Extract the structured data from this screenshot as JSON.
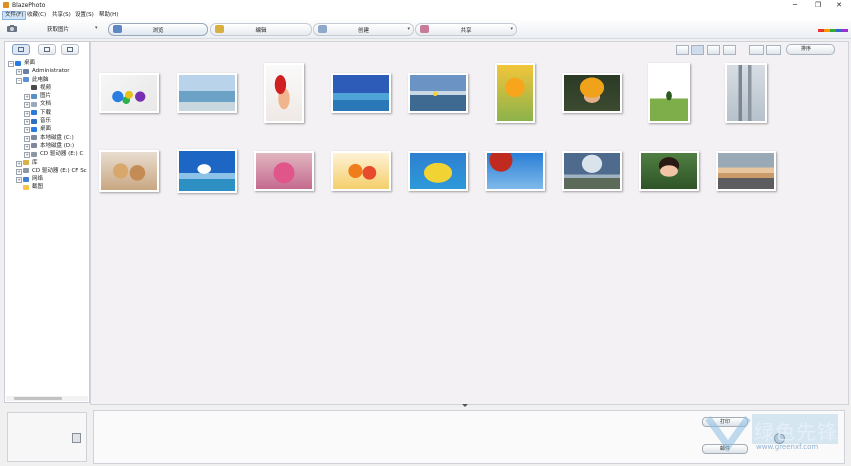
{
  "window": {
    "title": "BlazePhoto",
    "controls": {
      "minimize": "─",
      "maximize": "❐",
      "close": "✕"
    }
  },
  "menu": [
    {
      "label": "文件(F)",
      "active": true
    },
    {
      "label": "收藏(C)",
      "active": false
    },
    {
      "label": "共享(S)",
      "active": false
    },
    {
      "label": "设置(S)",
      "active": false
    },
    {
      "label": "帮助(H)",
      "active": false
    }
  ],
  "toolbar": {
    "import_label": "获取图片",
    "tabs": [
      {
        "label": "浏览",
        "selected": true,
        "icon": "browse-icon"
      },
      {
        "label": "编辑",
        "selected": false,
        "icon": "edit-icon"
      },
      {
        "label": "创建",
        "selected": false,
        "icon": "create-icon"
      },
      {
        "label": "共享",
        "selected": false,
        "icon": "share-icon"
      }
    ],
    "brand_colors": [
      "#e33",
      "#f90",
      "#3a3",
      "#36c",
      "#93c"
    ]
  },
  "tree": [
    {
      "label": "桌面",
      "level": 0,
      "exp": "−",
      "icon": "desktop-icon",
      "color": "#2a7be0"
    },
    {
      "label": "Administrator",
      "level": 1,
      "exp": "+",
      "icon": "user-icon",
      "color": "#6b7fa6"
    },
    {
      "label": "此电脑",
      "level": 1,
      "exp": "−",
      "icon": "computer-icon",
      "color": "#5b8fd6"
    },
    {
      "label": "视频",
      "level": 2,
      "exp": "",
      "icon": "video-icon",
      "color": "#4a4a4a"
    },
    {
      "label": "图片",
      "level": 2,
      "exp": "+",
      "icon": "pictures-icon",
      "color": "#5a8ec7"
    },
    {
      "label": "文档",
      "level": 2,
      "exp": "+",
      "icon": "documents-icon",
      "color": "#9aa9bb"
    },
    {
      "label": "下载",
      "level": 2,
      "exp": "+",
      "icon": "download-icon",
      "color": "#2b7cd6"
    },
    {
      "label": "音乐",
      "level": 2,
      "exp": "+",
      "icon": "music-icon",
      "color": "#2e6fc0"
    },
    {
      "label": "桌面",
      "level": 2,
      "exp": "+",
      "icon": "desktop-icon",
      "color": "#2a7be0"
    },
    {
      "label": "本地磁盘 (C:)",
      "level": 2,
      "exp": "+",
      "icon": "drive-icon",
      "color": "#7e8a99"
    },
    {
      "label": "本地磁盘 (D:)",
      "level": 2,
      "exp": "+",
      "icon": "drive-icon",
      "color": "#7e8a99"
    },
    {
      "label": "CD 驱动器 (E:) C",
      "level": 2,
      "exp": "+",
      "icon": "cd-drive-icon",
      "color": "#8d96a3"
    },
    {
      "label": "库",
      "level": 1,
      "exp": "+",
      "icon": "library-icon",
      "color": "#d7b24a"
    },
    {
      "label": "CD 驱动器 (E:) CF Sc",
      "level": 1,
      "exp": "+",
      "icon": "cd-drive-icon",
      "color": "#8d96a3"
    },
    {
      "label": "网络",
      "level": 1,
      "exp": "+",
      "icon": "network-icon",
      "color": "#3f7fd0"
    },
    {
      "label": "截图",
      "level": 1,
      "exp": "",
      "icon": "folder-icon",
      "color": "#f3c64b"
    }
  ],
  "viewbar": {
    "sort_label": "排序"
  },
  "photos": [
    {
      "name": "eggs",
      "bg": "linear-gradient(135deg,#f6f6f6,#e8e8e8)",
      "accent": "radial-gradient(circle at 30% 60%,#2a7de1 0 12%,transparent 13%),radial-gradient(circle at 50% 55%,#e6c21e 0 11%,transparent 12%),radial-gradient(circle at 70% 60%,#7a2fb0 0 11%,transparent 12%),radial-gradient(circle at 45% 70%,#2bb24c 0 9%,transparent 10%)"
    },
    {
      "name": "pier",
      "bg": "linear-gradient(#b9d4ea 0 45%,#6da2c7 45% 75%,#c9d8df 75%)",
      "accent": ""
    },
    {
      "name": "santa",
      "bg": "linear-gradient(#fafafa,#efe9e6)",
      "accent": "radial-gradient(ellipse at 40% 35%,#d02020 0 18%,transparent 19%),radial-gradient(ellipse at 50% 60%,#f0b58f 0 22%,transparent 23%)"
    },
    {
      "name": "island",
      "bg": "linear-gradient(#2d5cb8 0 50%,#4ea4d6 50% 70%,#2a78b8 70%)",
      "accent": ""
    },
    {
      "name": "lake",
      "bg": "linear-gradient(#6b93c4 0 45%,#c8d8e4 45% 55%,#3e6a91 55%)",
      "accent": "radial-gradient(circle at 45% 52%,#f3d23c 0 6%,transparent 7%)"
    },
    {
      "name": "yellow-flower",
      "bg": "linear-gradient(#f3c53a,#8bb34b)",
      "accent": "radial-gradient(circle at 50% 40%,#f7a51c 0 25%,transparent 26%)"
    },
    {
      "name": "kid-hat",
      "bg": "linear-gradient(#2b3a25,#3c4a30)",
      "accent": "radial-gradient(ellipse at 50% 35%,#f0a21a 0 30%,transparent 31%),radial-gradient(ellipse at 50% 60%,#e3b089 0 20%,transparent 21%)"
    },
    {
      "name": "tree",
      "bg": "linear-gradient(#ffffff 0 60%,#7eae4a 60%)",
      "accent": "radial-gradient(ellipse at 50% 55%,#2c5a1f 0 10%,transparent 11%)"
    },
    {
      "name": "city",
      "bg": "linear-gradient(#d7dde3,#b6c1cb)",
      "accent": "linear-gradient(90deg,transparent 30%,#7b8692 30% 40%,transparent 40% 55%,#8a95a0 55% 65%,transparent 65%)"
    },
    {
      "name": "bears",
      "bg": "linear-gradient(#e8ddd0,#c9a782)",
      "accent": "radial-gradient(circle at 35% 50%,#d8a76c 0 18%,transparent 19%),radial-gradient(circle at 65% 55%,#c48c55 0 18%,transparent 19%)"
    },
    {
      "name": "sky",
      "bg": "linear-gradient(#1e66c4 0 55%,#8dc2e8 55% 70%,#2d8fc2 70%)",
      "accent": "radial-gradient(ellipse at 45% 45%,#ffffff 0 15%,transparent 16%)"
    },
    {
      "name": "pink-flowers",
      "bg": "linear-gradient(#e1b5c0,#c46a8e)",
      "accent": "radial-gradient(circle at 50% 55%,#e0558a 0 30%,transparent 31%)"
    },
    {
      "name": "fruit",
      "bg": "linear-gradient(#fff3d6,#f4cf6a)",
      "accent": "radial-gradient(circle at 40% 50%,#f07d1c 0 18%,transparent 19%),radial-gradient(circle at 65% 55%,#e84b2c 0 16%,transparent 17%)"
    },
    {
      "name": "pool",
      "bg": "linear-gradient(#2e7fd0,#2d9ad9)",
      "accent": "radial-gradient(ellipse at 50% 55%,#f2d334 0 35%,transparent 36%),radial-gradient(circle at 45% 45%,#f0bd93 0 12%,transparent 13%)"
    },
    {
      "name": "red-leaves",
      "bg": "linear-gradient(#2a7ed6,#7fb9ea)",
      "accent": "radial-gradient(circle at 25% 20%,#c02a1f 0 22%,transparent 23%)"
    },
    {
      "name": "clouds",
      "bg": "linear-gradient(#4e6a8c 0 60%,#9fb3c2 60% 70%,#5c6a5a 70%)",
      "accent": "radial-gradient(ellipse at 50% 30%,#d9e3ec 0 25%,transparent 26%)"
    },
    {
      "name": "girl",
      "bg": "linear-gradient(#4f7f42,#2f5427)",
      "accent": "radial-gradient(ellipse at 50% 50%,#f0c4a4 0 22%,transparent 23%),radial-gradient(ellipse at 50% 35%,#2b1a14 0 25%,transparent 26%)"
    },
    {
      "name": "sunset",
      "bg": "linear-gradient(#9aa9b6 0 40%,#e7c6a0 40% 55%,#c99a6a 55% 70%,#5c5c5e 70%)",
      "accent": ""
    }
  ],
  "bottom": {
    "btn1": "打印",
    "btn2": "邮件",
    "watermark": "绿色先锋",
    "watermark_url": "www.greenxf.com"
  }
}
